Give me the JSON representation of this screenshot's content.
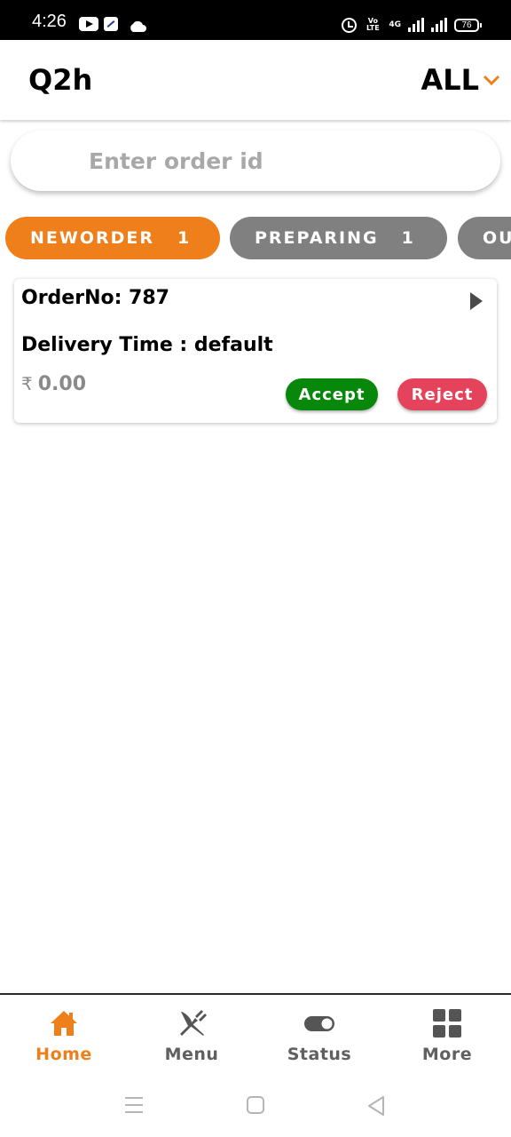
{
  "status_bar": {
    "time": "4:26",
    "volte": "Vo LTE",
    "network": "4G",
    "battery": "76",
    "icons": [
      "youtube-icon",
      "app-icon",
      "cloud-icon",
      "alarm-icon",
      "volte-icon",
      "signal-icon",
      "battery-icon"
    ]
  },
  "header": {
    "title": "Q2h",
    "filter": "ALL"
  },
  "search": {
    "placeholder": "Enter order id",
    "value": ""
  },
  "tabs": [
    {
      "label": "NEWORDER",
      "count": "1",
      "active": true
    },
    {
      "label": "PREPARING",
      "count": "1",
      "active": false
    },
    {
      "label": "OU",
      "count": "",
      "active": false
    }
  ],
  "order": {
    "order_no": "OrderNo: 787",
    "delivery_time": "Delivery Time : default",
    "currency": "₹",
    "amount": "0.00",
    "accept_label": "Accept",
    "reject_label": "Reject"
  },
  "bottom_nav": [
    {
      "label": "Home",
      "icon": "home-icon",
      "active": true
    },
    {
      "label": "Menu",
      "icon": "utensils-icon",
      "active": false
    },
    {
      "label": "Status",
      "icon": "toggle-icon",
      "active": false
    },
    {
      "label": "More",
      "icon": "grid-icon",
      "active": false
    }
  ],
  "colors": {
    "accent": "#ef7f1a",
    "tab_inactive": "#808080",
    "accept": "#08880a",
    "reject": "#e5435c"
  }
}
